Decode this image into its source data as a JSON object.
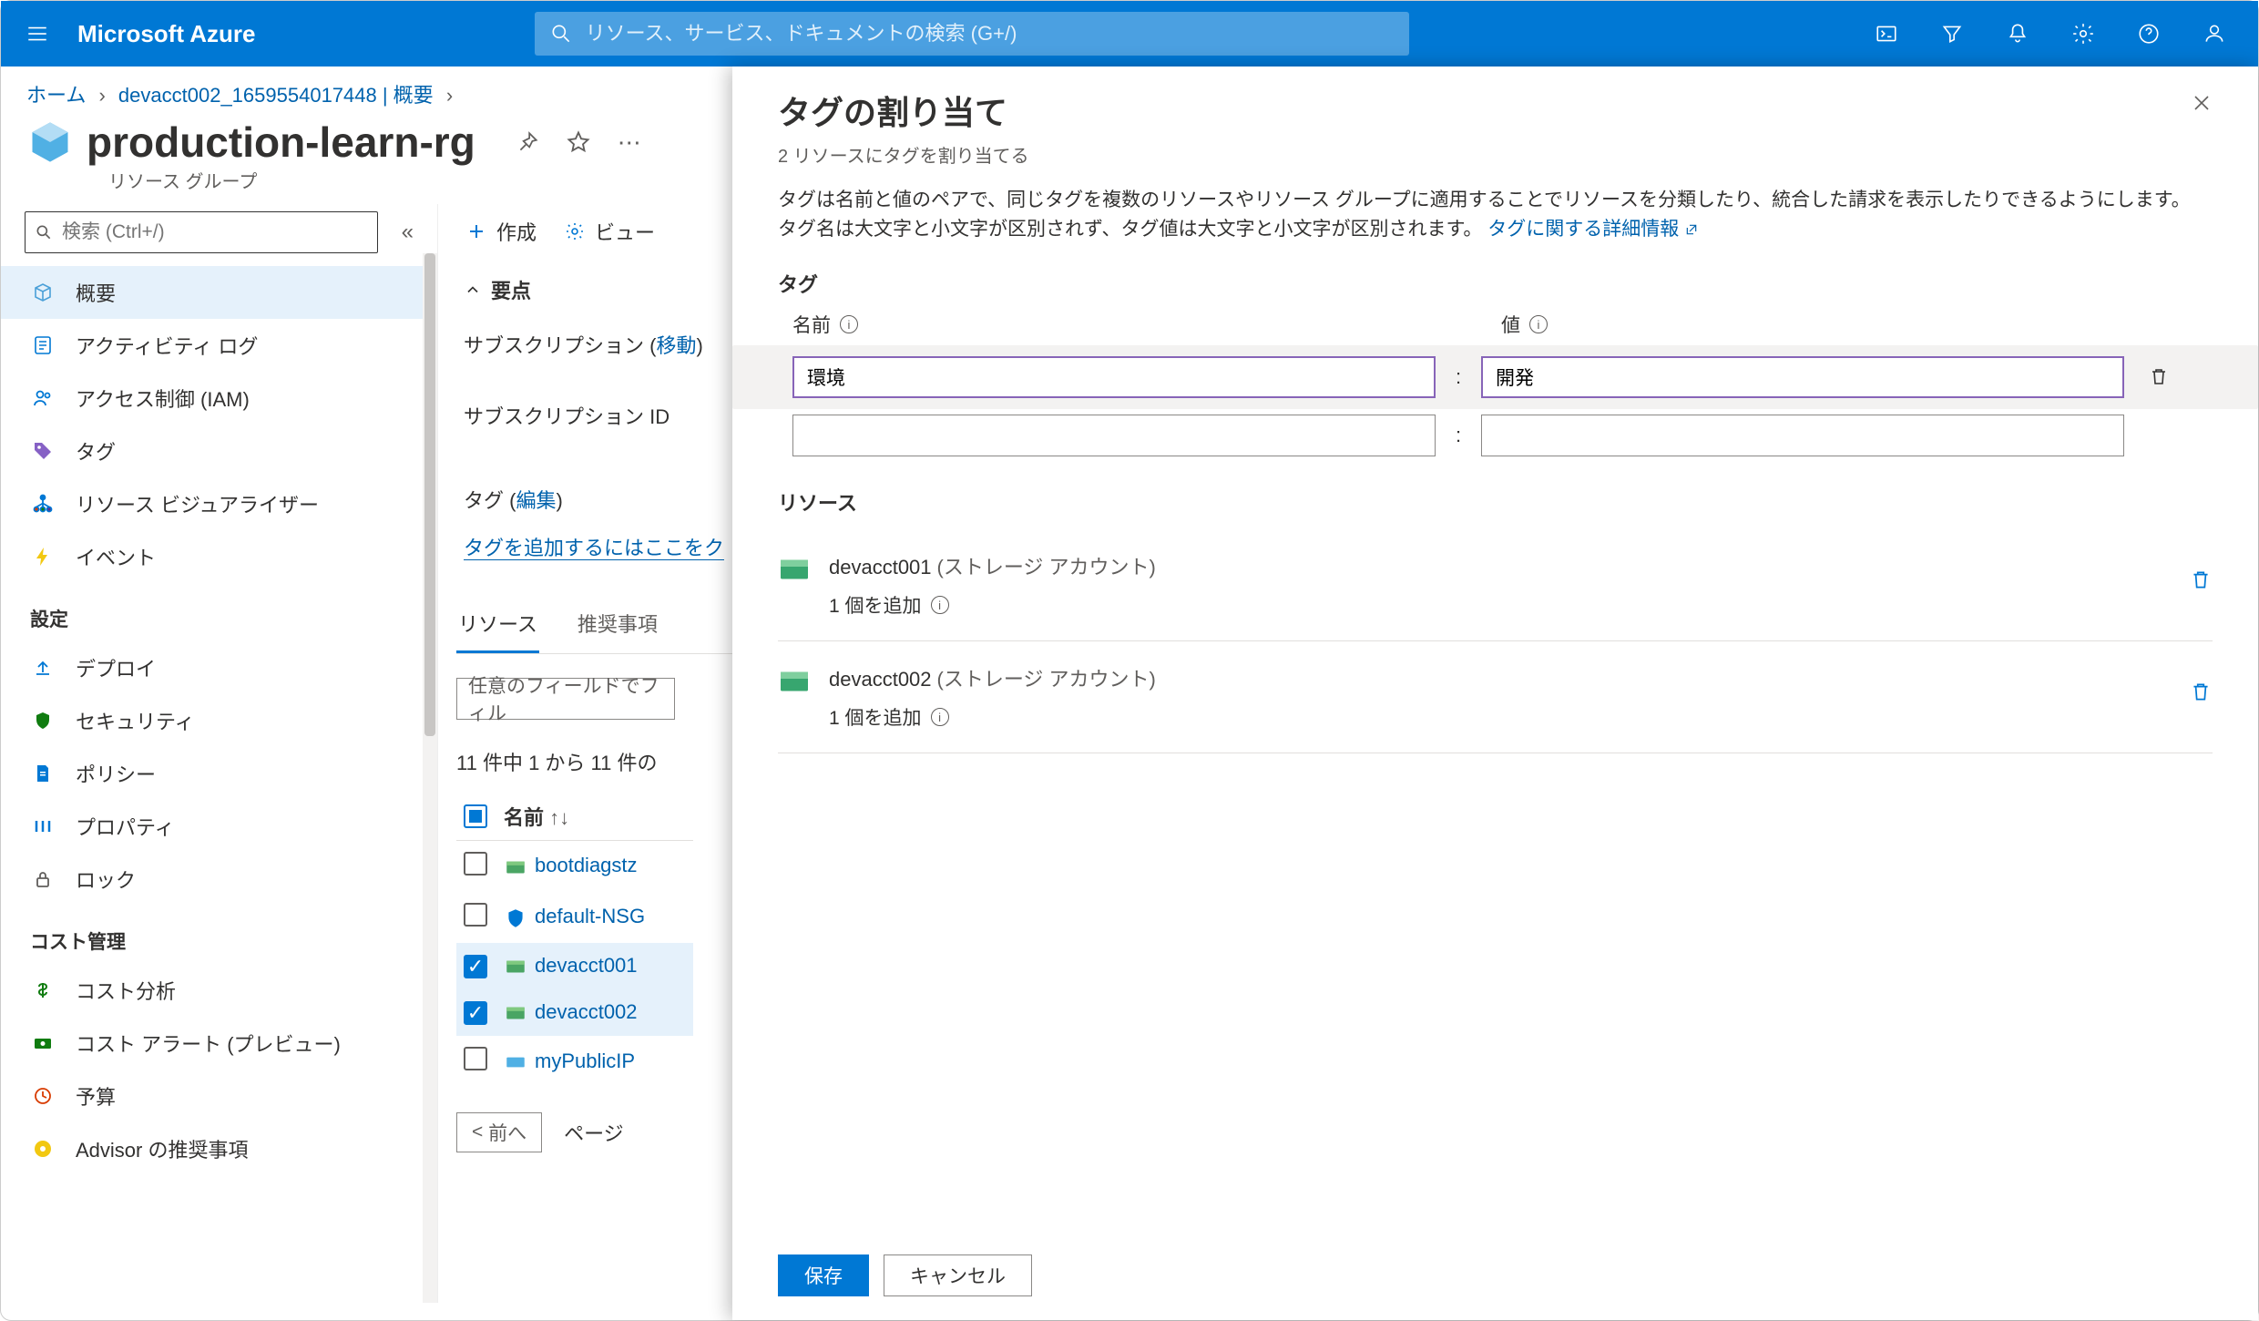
{
  "header": {
    "brand": "Microsoft Azure",
    "search_placeholder": "リソース、サービス、ドキュメントの検索 (G+/)"
  },
  "breadcrumb": {
    "home": "ホーム",
    "item": "devacct002_1659554017448 | 概要"
  },
  "page": {
    "title": "production-learn-rg",
    "subtitle": "リソース グループ"
  },
  "sidebar": {
    "search_placeholder": "検索 (Ctrl+/)",
    "collapse_glyph": "«",
    "items": [
      {
        "label": "概要",
        "active": true,
        "icon": "cube"
      },
      {
        "label": "アクティビティ ログ",
        "icon": "log"
      },
      {
        "label": "アクセス制御 (IAM)",
        "icon": "person"
      },
      {
        "label": "タグ",
        "icon": "tag"
      },
      {
        "label": "リソース ビジュアライザー",
        "icon": "tree"
      },
      {
        "label": "イベント",
        "icon": "bolt"
      }
    ],
    "section_settings": "設定",
    "settings_items": [
      {
        "label": "デプロイ",
        "icon": "upload"
      },
      {
        "label": "セキュリティ",
        "icon": "shield"
      },
      {
        "label": "ポリシー",
        "icon": "doc"
      },
      {
        "label": "プロパティ",
        "icon": "props"
      },
      {
        "label": "ロック",
        "icon": "lock"
      }
    ],
    "section_cost": "コスト管理",
    "cost_items": [
      {
        "label": "コスト分析",
        "icon": "dollar"
      },
      {
        "label": "コスト アラート (プレビュー)",
        "icon": "money"
      },
      {
        "label": "予算",
        "icon": "budget"
      },
      {
        "label": "Advisor の推奨事項",
        "icon": "advisor"
      }
    ]
  },
  "toolbar": {
    "create": "作成",
    "view": "ビュー"
  },
  "essentials": {
    "toggle": "要点",
    "subscription_label": "サブスクリプション (",
    "subscription_move": "移動",
    "subscription_close": ")",
    "subscription_id_label": "サブスクリプション ID",
    "tags_label": "タグ (",
    "tags_edit": "編集",
    "tags_close": ")",
    "tags_add": "タグを追加するにはここをク"
  },
  "tabs": {
    "resources": "リソース",
    "recommend": "推奨事項"
  },
  "list": {
    "filter_placeholder": "任意のフィールドでフィル",
    "count": "11 件中 1 から 11 件の",
    "col_name": "名前",
    "rows": [
      {
        "name": "bootdiagstz",
        "checked": false,
        "type": "storage"
      },
      {
        "name": "default-NSG",
        "checked": false,
        "type": "shield"
      },
      {
        "name": "devacct001",
        "checked": true,
        "type": "storage"
      },
      {
        "name": "devacct002",
        "checked": true,
        "type": "storage"
      },
      {
        "name": "myPublicIP",
        "checked": false,
        "type": "ip"
      }
    ],
    "prev": "前へ",
    "page": "ページ"
  },
  "panel": {
    "title": "タグの割り当て",
    "subtitle": "2 リソースにタグを割り当てる",
    "desc1": "タグは名前と値のペアで、同じタグを複数のリソースやリソース グループに適用することでリソースを分類したり、統合した請求を表示したりできるようにします。",
    "desc2": "タグ名は大文字と小文字が区別されず、タグ値は大文字と小文字が区別されます。",
    "learn_more": "タグに関する詳細情報",
    "section_tags": "タグ",
    "col_name": "名前",
    "col_value": "値",
    "tag_name": "環境",
    "tag_value": "開発",
    "section_resources": "リソース",
    "resources": [
      {
        "name": "devacct001",
        "type": "(ストレージ アカウント)",
        "add": "1 個を追加"
      },
      {
        "name": "devacct002",
        "type": "(ストレージ アカウント)",
        "add": "1 個を追加"
      }
    ],
    "save": "保存",
    "cancel": "キャンセル"
  }
}
